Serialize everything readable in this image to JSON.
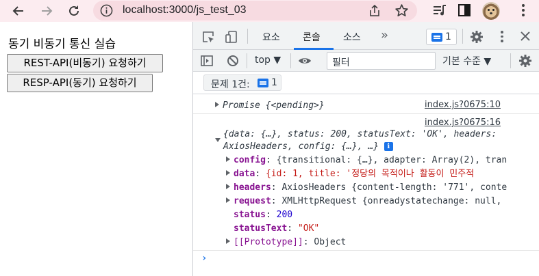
{
  "browser": {
    "url": "localhost:3000/js_test_03"
  },
  "page": {
    "heading": "동기 비동기 통신 실습",
    "buttons": {
      "rest": "REST-API(비동기) 요청하기",
      "resp": "RESP-API(동기) 요청하기"
    }
  },
  "devtools": {
    "tabs": [
      "요소",
      "콘솔",
      "소스"
    ],
    "active_tab": "콘솔",
    "more": "»",
    "message_count": "1",
    "context": "top ▼",
    "filter_placeholder": "필터",
    "level": "기본 수준 ▼",
    "issues_label": "문제 1건:",
    "issues_count": "1"
  },
  "console": {
    "entry1": {
      "text": "Promise {<pending>}",
      "source": "index.js?0675:10"
    },
    "entry2": {
      "source": "index.js?0675:16",
      "summary_line1": "{data: {…}, status: 200, statusText: 'OK', headers:",
      "summary_line2": "AxiosHeaders, config: {…}, …}",
      "info_badge": "i",
      "props": [
        {
          "key": "config",
          "value": "{transitional: {…}, adapter: Array(2), tran",
          "expandable": true
        },
        {
          "key": "data",
          "value": "{id: 1, title: '정당의 목적이나 활동이 민주적",
          "expandable": true
        },
        {
          "key": "headers",
          "value": "AxiosHeaders {content-length: '771', conte",
          "expandable": true
        },
        {
          "key": "request",
          "value": "XMLHttpRequest {onreadystatechange: null,",
          "expandable": true
        },
        {
          "key": "status",
          "value": "200",
          "expandable": false
        },
        {
          "key": "statusText",
          "value": "\"OK\"",
          "expandable": false
        },
        {
          "key": "[[Prototype]]",
          "value": "Object",
          "expandable": true
        }
      ]
    },
    "prompt": "›"
  }
}
